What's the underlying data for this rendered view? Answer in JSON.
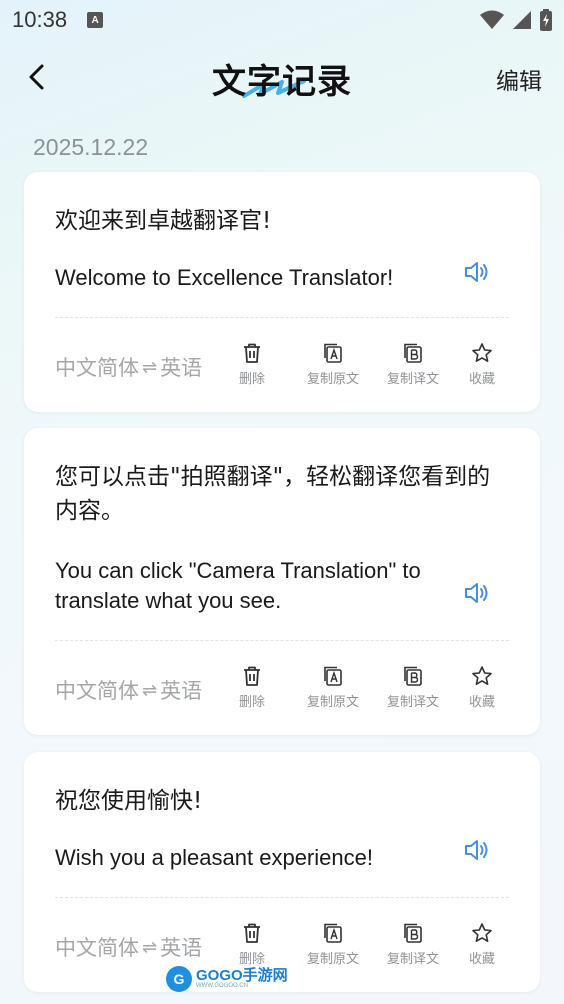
{
  "status_bar": {
    "time": "10:38",
    "app_icon": "A"
  },
  "header": {
    "title": "文字记录",
    "edit_label": "编辑"
  },
  "date": "2025.12.22",
  "records": [
    {
      "source_text": "欢迎来到卓越翻译官!",
      "target_text": "Welcome to Excellence Translator!",
      "source_lang": "中文简体",
      "target_lang": "英语"
    },
    {
      "source_text": "您可以点击\"拍照翻译\"，轻松翻译您看到的内容。",
      "target_text": "You can click \"Camera Translation\" to translate what you see.",
      "source_lang": "中文简体",
      "target_lang": "英语"
    },
    {
      "source_text": "祝您使用愉快!",
      "target_text": "Wish you a pleasant experience!",
      "source_lang": "中文简体",
      "target_lang": "英语"
    }
  ],
  "actions": {
    "delete": "删除",
    "copy_source": "复制原文",
    "copy_target": "复制译文",
    "favorite": "收藏"
  },
  "lang_arrow": "⇌",
  "watermark": {
    "badge": "G",
    "text": "GOGO手游网",
    "sub": "WWW.GOGOO.CN"
  },
  "colors": {
    "accent": "#4a8fd6",
    "muted": "#a3a7aa",
    "card_bg": "#ffffff"
  }
}
